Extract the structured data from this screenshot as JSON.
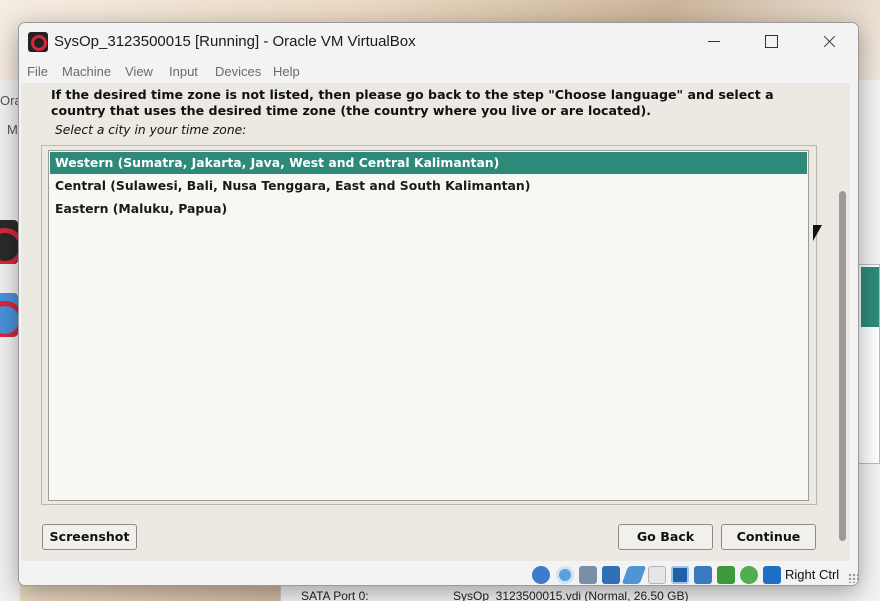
{
  "window": {
    "title": "SysOp_3123500015 [Running] - Oracle VM VirtualBox"
  },
  "menu": {
    "items": [
      "File",
      "Machine",
      "View",
      "Input",
      "Devices",
      "Help"
    ]
  },
  "installer": {
    "heading": "If the desired time zone is not listed, then please go back to the step \"Choose language\" and select a country that uses the desired time zone (the country where you live or are located).",
    "prompt": "Select a city in your time zone:",
    "options": [
      "Western (Sumatra, Jakarta, Java, West and Central Kalimantan)",
      "Central (Sulawesi, Bali, Nusa Tenggara, East and South Kalimantan)",
      "Eastern (Maluku, Papua)"
    ],
    "selected_option": "Western (Sumatra, Jakarta, Java, West and Central Kalimantan)",
    "buttons": {
      "screenshot": "Screenshot",
      "go_back": "Go Back",
      "continue": "Continue"
    }
  },
  "statusbar": {
    "host_key": "Right Ctrl",
    "icons": [
      "hard-disk-icon",
      "optical-drive-icon",
      "audio-icon",
      "network-icon",
      "usb-icon",
      "shared-folders-icon",
      "display-icon",
      "recording-icon",
      "mouse-integration-icon",
      "cpu-icon",
      "keyboard-icon"
    ]
  },
  "background": {
    "manager_fragment_1": "Ora",
    "manager_fragment_2": "M",
    "storage_label": "SATA Port 0:",
    "storage_value": "SysOp_3123500015.vdi (Normal, 26.50 GB)"
  },
  "colors": {
    "selection": "#2d8a78",
    "accent_red": "#d7263d"
  }
}
